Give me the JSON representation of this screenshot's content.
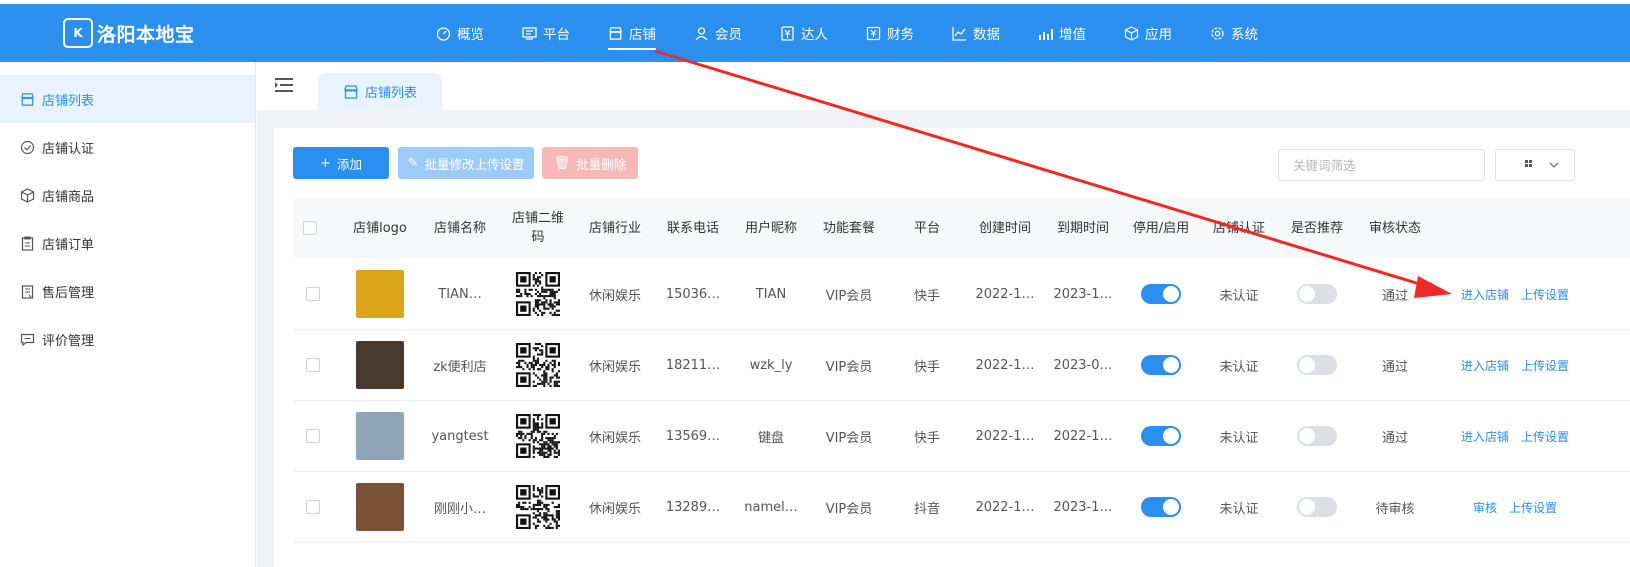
{
  "app": {
    "logo_mark": "K",
    "title": "洛阳本地宝"
  },
  "nav": [
    {
      "label": "概览",
      "icon": "dashboard-icon"
    },
    {
      "label": "平台",
      "icon": "monitor-icon"
    },
    {
      "label": "店铺",
      "icon": "store-icon",
      "active": true
    },
    {
      "label": "会员",
      "icon": "user-icon"
    },
    {
      "label": "达人",
      "icon": "influencer-icon"
    },
    {
      "label": "财务",
      "icon": "finance-icon"
    },
    {
      "label": "数据",
      "icon": "line-chart-icon"
    },
    {
      "label": "增值",
      "icon": "bar-chart-icon"
    },
    {
      "label": "应用",
      "icon": "cube-icon"
    },
    {
      "label": "系统",
      "icon": "gear-icon"
    }
  ],
  "sidebar": {
    "items": [
      {
        "label": "店铺列表",
        "icon": "store-icon",
        "active": true
      },
      {
        "label": "店铺认证",
        "icon": "verify-icon"
      },
      {
        "label": "店铺商品",
        "icon": "cube-icon"
      },
      {
        "label": "店铺订单",
        "icon": "order-icon"
      },
      {
        "label": "售后管理",
        "icon": "after-sales-icon"
      },
      {
        "label": "评价管理",
        "icon": "comment-icon"
      }
    ]
  },
  "tabs": [
    {
      "label": "店铺列表",
      "icon": "store-icon"
    }
  ],
  "toolbar": {
    "add_label": "添加",
    "batch_label": "批量修改上传设置",
    "delete_label": "批量删除",
    "search_placeholder": "关键词筛选"
  },
  "table": {
    "headers": {
      "logo": "店铺logo",
      "name": "店铺名称",
      "qr_line1": "店铺二维",
      "qr_line2": "码",
      "industry": "店铺行业",
      "phone": "联系电话",
      "nickname": "用户昵称",
      "package": "功能套餐",
      "platform": "平台",
      "created": "创建时间",
      "expire": "到期时间",
      "enabled": "停用/启用",
      "certified": "店铺认证",
      "recommend": "是否推荐",
      "review": "审核状态"
    },
    "rows": [
      {
        "name": "TIAN…",
        "industry": "休闲娱乐",
        "phone": "15036…",
        "nickname": "TIAN",
        "package": "VIP会员",
        "platform": "快手",
        "created": "2022-1…",
        "expire": "2023-1…",
        "enabled": true,
        "certified": "未认证",
        "recommend": false,
        "review": "通过",
        "actions": [
          "进入店铺",
          "上传设置"
        ],
        "thumb_color": "#d9a51a"
      },
      {
        "name": "zk便利店",
        "industry": "休闲娱乐",
        "phone": "18211…",
        "nickname": "wzk_ly",
        "package": "VIP会员",
        "platform": "快手",
        "created": "2022-1…",
        "expire": "2023-0…",
        "enabled": true,
        "certified": "未认证",
        "recommend": false,
        "review": "通过",
        "actions": [
          "进入店铺",
          "上传设置"
        ],
        "thumb_color": "#4a3a2e"
      },
      {
        "name": "yangtest",
        "industry": "休闲娱乐",
        "phone": "13569…",
        "nickname": "键盘",
        "package": "VIP会员",
        "platform": "快手",
        "created": "2022-1…",
        "expire": "2022-1…",
        "enabled": true,
        "certified": "未认证",
        "recommend": false,
        "review": "通过",
        "actions": [
          "进入店铺",
          "上传设置"
        ],
        "thumb_color": "#8fa6b8"
      },
      {
        "name": "刚刚小…",
        "industry": "休闲娱乐",
        "phone": "13289…",
        "nickname": "namel…",
        "package": "VIP会员",
        "platform": "抖音",
        "created": "2022-1…",
        "expire": "2023-1…",
        "enabled": true,
        "certified": "未认证",
        "recommend": false,
        "review": "待审核",
        "actions": [
          "审核",
          "上传设置"
        ],
        "thumb_color": "#7a5036"
      }
    ]
  },
  "colors": {
    "primary": "#2b8ff0",
    "annotation_arrow": "#ee2a24"
  }
}
